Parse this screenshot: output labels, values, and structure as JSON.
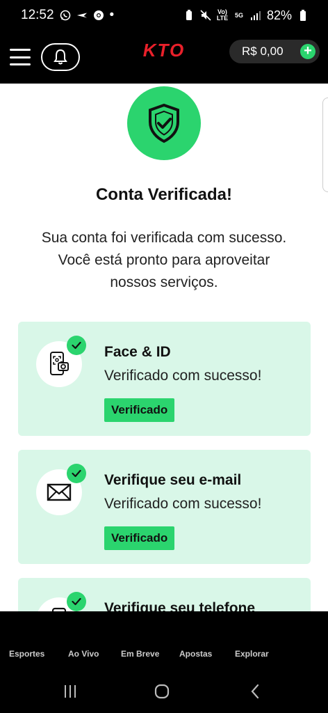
{
  "status_bar": {
    "time": "12:52",
    "battery": "82%",
    "network_5g": "5G",
    "volte": "Vo) LTE"
  },
  "header": {
    "logo": "KTO",
    "balance": "R$ 0,00",
    "plus": "+"
  },
  "main": {
    "title": "Conta Verificada!",
    "subtitle_lines": [
      "Sua conta foi verificada com sucesso.",
      "Você está pronto para aproveitar",
      "nossos serviços."
    ],
    "cards": [
      {
        "title": "Face & ID",
        "status": "Verificado com sucesso!",
        "badge": "Verificado",
        "icon": "face-id-phone-icon"
      },
      {
        "title": "Verifique seu e-mail",
        "status": "Verificado com sucesso!",
        "badge": "Verificado",
        "icon": "envelope-icon"
      },
      {
        "title": "Verifique seu telefone",
        "icon": "phone-icon"
      }
    ]
  },
  "bottom_nav": {
    "items": [
      "Esportes",
      "Ao Vivo",
      "Em Breve",
      "Apostas",
      "Explorar"
    ]
  },
  "colors": {
    "accent": "#2bd46e",
    "card_bg": "#d9f7e8",
    "logo_red": "#e8202a"
  }
}
